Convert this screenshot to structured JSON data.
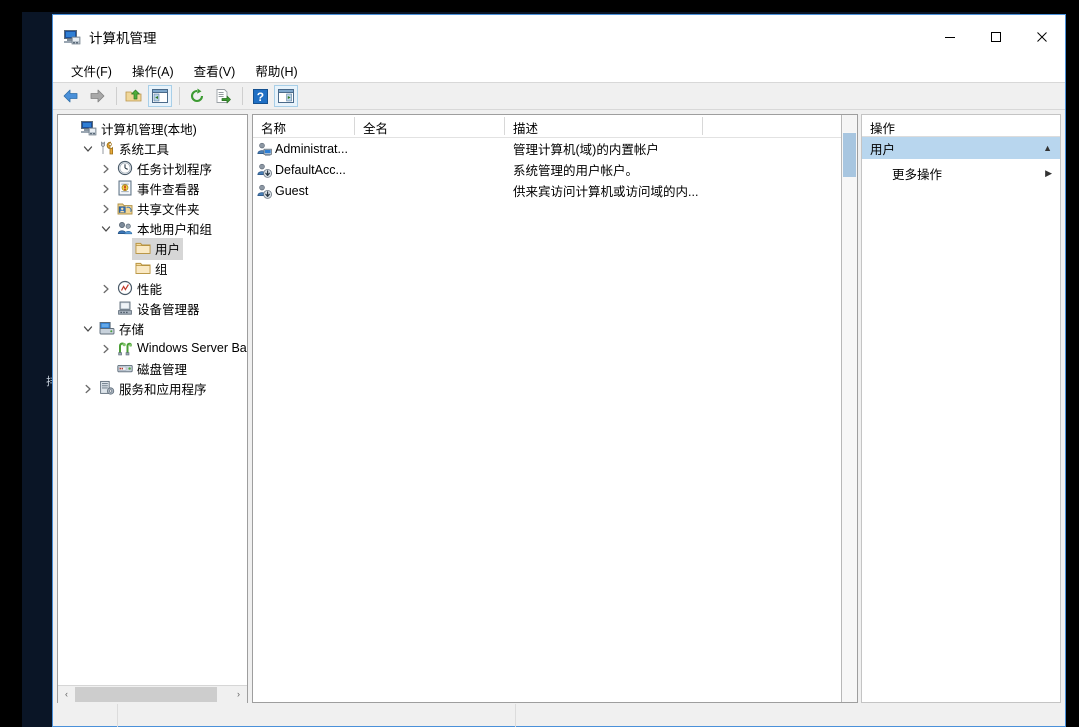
{
  "window": {
    "title": "计算机管理",
    "title_icon": "computer-management-icon",
    "caption": {
      "minimize": "–",
      "maximize": "□",
      "close": "✕",
      "minimize_name": "minimize-button",
      "maximize_name": "maximize-button",
      "close_name": "close-button"
    }
  },
  "menubar": {
    "items": [
      {
        "label": "文件(F)",
        "name": "menu-file"
      },
      {
        "label": "操作(A)",
        "name": "menu-action"
      },
      {
        "label": "查看(V)",
        "name": "menu-view"
      },
      {
        "label": "帮助(H)",
        "name": "menu-help"
      }
    ]
  },
  "toolbar": {
    "buttons": [
      {
        "icon": "back-arrow-icon",
        "framed": false
      },
      {
        "icon": "forward-arrow-icon",
        "framed": false
      },
      {
        "sep": true
      },
      {
        "icon": "up-folder-icon",
        "framed": false
      },
      {
        "icon": "show-hide-tree-icon",
        "framed": true
      },
      {
        "sep": true
      },
      {
        "icon": "refresh-icon",
        "framed": false
      },
      {
        "icon": "export-list-icon",
        "framed": false
      },
      {
        "sep": true
      },
      {
        "icon": "help-icon",
        "framed": false
      },
      {
        "icon": "show-action-pane-icon",
        "framed": true
      }
    ]
  },
  "tree": {
    "items": [
      {
        "label": "计算机管理(本地)",
        "indent": 0,
        "twisty": "none",
        "icon": "computer-management-icon",
        "selected": false,
        "name": "tree-item-computer-management"
      },
      {
        "label": "系统工具",
        "indent": 1,
        "twisty": "expanded",
        "icon": "system-tools-icon",
        "selected": false,
        "name": "tree-item-system-tools"
      },
      {
        "label": "任务计划程序",
        "indent": 2,
        "twisty": "collapsed",
        "icon": "task-scheduler-icon",
        "selected": false,
        "name": "tree-item-task-scheduler"
      },
      {
        "label": "事件查看器",
        "indent": 2,
        "twisty": "collapsed",
        "icon": "event-viewer-icon",
        "selected": false,
        "name": "tree-item-event-viewer"
      },
      {
        "label": "共享文件夹",
        "indent": 2,
        "twisty": "collapsed",
        "icon": "shared-folders-icon",
        "selected": false,
        "name": "tree-item-shared-folders"
      },
      {
        "label": "本地用户和组",
        "indent": 2,
        "twisty": "expanded",
        "icon": "local-users-groups-icon",
        "selected": false,
        "name": "tree-item-local-users-and-groups"
      },
      {
        "label": "用户",
        "indent": 3,
        "twisty": "none",
        "icon": "folder-icon",
        "selected": true,
        "name": "tree-item-users"
      },
      {
        "label": "组",
        "indent": 3,
        "twisty": "none",
        "icon": "folder-icon",
        "selected": false,
        "name": "tree-item-groups"
      },
      {
        "label": "性能",
        "indent": 2,
        "twisty": "collapsed",
        "icon": "performance-icon",
        "selected": false,
        "name": "tree-item-performance"
      },
      {
        "label": "设备管理器",
        "indent": 2,
        "twisty": "none",
        "icon": "device-manager-icon",
        "selected": false,
        "name": "tree-item-device-manager"
      },
      {
        "label": "存储",
        "indent": 1,
        "twisty": "expanded",
        "icon": "storage-icon",
        "selected": false,
        "name": "tree-item-storage"
      },
      {
        "label": "Windows Server Back",
        "indent": 2,
        "twisty": "collapsed",
        "icon": "windows-server-backup-icon",
        "selected": false,
        "name": "tree-item-windows-server-backup"
      },
      {
        "label": "磁盘管理",
        "indent": 2,
        "twisty": "none",
        "icon": "disk-management-icon",
        "selected": false,
        "name": "tree-item-disk-management"
      },
      {
        "label": "服务和应用程序",
        "indent": 1,
        "twisty": "collapsed",
        "icon": "services-applications-icon",
        "selected": false,
        "name": "tree-item-services-and-applications"
      }
    ],
    "hscroll": {
      "left_arrow": "‹",
      "right_arrow": "›"
    }
  },
  "list": {
    "columns": [
      {
        "label": "名称",
        "width": 102,
        "name": "column-header-name"
      },
      {
        "label": "全名",
        "width": 150,
        "name": "column-header-fullname"
      },
      {
        "label": "描述",
        "width": 198,
        "name": "column-header-description"
      },
      {
        "label": "",
        "width": 130,
        "name": "column-header-blank"
      }
    ],
    "rows": [
      {
        "name": "Administrat...",
        "fullname": "",
        "description": "管理计算机(域)的内置帐户",
        "icon": "user-admin-icon"
      },
      {
        "name": "DefaultAcc...",
        "fullname": "",
        "description": "系统管理的用户帐户。",
        "icon": "user-disabled-icon"
      },
      {
        "name": "Guest",
        "fullname": "",
        "description": "供来宾访问计算机或访问域的内...",
        "icon": "user-disabled-icon"
      }
    ]
  },
  "actions": {
    "title": "操作",
    "group": {
      "label": "用户",
      "collapse_glyph": "▲",
      "name": "actions-group-users"
    },
    "items": [
      {
        "label": "更多操作",
        "arrow": "▶",
        "name": "action-more-actions"
      }
    ]
  },
  "statusbar": {
    "segments": [
      "",
      "",
      ""
    ]
  },
  "desktop": {
    "edge_glyph": "排"
  },
  "colors": {
    "window_border": "#4a90d9",
    "desktop": "#0a1526",
    "actions_group": "#b8d6ee",
    "tree_selection": "#d6d6d6",
    "scrollbar_thumb": "#a8c6e0"
  }
}
